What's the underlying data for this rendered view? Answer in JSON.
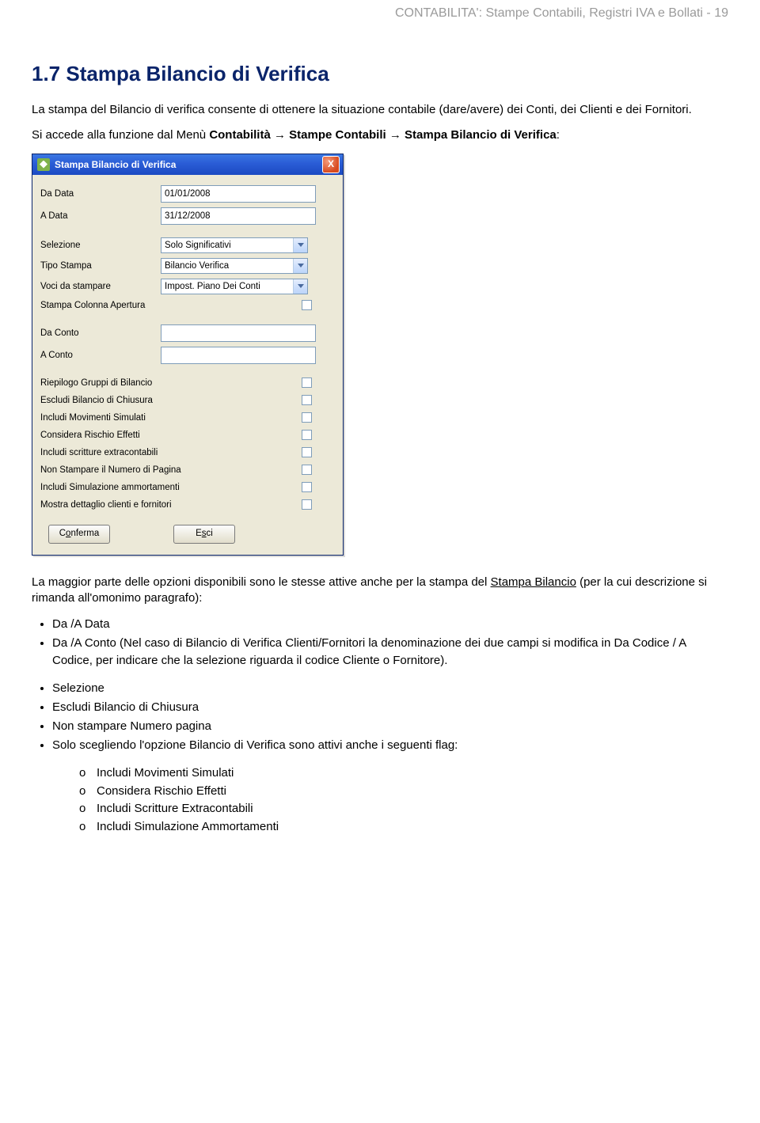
{
  "header": "CONTABILITA': Stampe Contabili, Registri IVA e Bollati - 19",
  "sectionTitle": "1.7 Stampa Bilancio di Verifica",
  "intro": "La stampa del Bilancio di verifica consente di ottenere la situazione contabile (dare/avere) dei Conti, dei Clienti e dei Fornitori.",
  "navPrefix": "Si accede alla funzione dal Menù ",
  "nav": {
    "m1": "Contabilità",
    "m2": "Stampe Contabili",
    "m3": "Stampa Bilancio di Verifica",
    "arrow": "→"
  },
  "colon": ":",
  "dialog": {
    "title": "Stampa Bilancio di Verifica",
    "close": "X",
    "fields": {
      "daData": {
        "label": "Da Data",
        "value": "01/01/2008"
      },
      "aData": {
        "label": "A Data",
        "value": "31/12/2008"
      },
      "selezione": {
        "label": "Selezione",
        "value": "Solo Significativi"
      },
      "tipoStampa": {
        "label": "Tipo Stampa",
        "value": "Bilancio Verifica"
      },
      "voci": {
        "label": "Voci da stampare",
        "value": "Impost. Piano Dei Conti"
      },
      "colApertura": {
        "label": "Stampa Colonna Apertura"
      },
      "daConto": {
        "label": "Da Conto",
        "value": ""
      },
      "aConto": {
        "label": "A Conto",
        "value": ""
      }
    },
    "checks": [
      "Riepilogo Gruppi di Bilancio",
      "Escludi Bilancio di Chiusura",
      "Includi Movimenti Simulati",
      "Considera Rischio Effetti",
      "Includi scritture extracontabili",
      "Non Stampare il Numero di Pagina",
      "Includi Simulazione ammortamenti",
      "Mostra dettaglio clienti e fornitori"
    ],
    "buttons": {
      "confirmPre": "C",
      "confirmUL": "o",
      "confirmPost": "nferma",
      "exitPre": "E",
      "exitUL": "s",
      "exitPost": "ci"
    }
  },
  "afterDlg1a": "La maggior parte delle opzioni disponibili sono le stesse attive anche per la stampa del ",
  "afterDlg1Link": "Stampa Bilancio",
  "afterDlg1b": " (per la cui descrizione si rimanda all'omonimo paragrafo):",
  "bulletsA": {
    "b1": "Da /A Data",
    "b2a": "Da /A Conto",
    "b2b": "   (Nel caso di Bilancio di Verifica Clienti/Fornitori la denominazione dei due campi si modifica in ",
    "b2c": "Da Codice / A Codice",
    "b2d": ", per indicare che la selezione riguarda il codice Cliente o Fornitore)."
  },
  "bulletsB": {
    "b1": "Selezione",
    "b2": "Escludi Bilancio di Chiusura",
    "b3": "Non stampare Numero pagina",
    "b4": "Solo scegliendo l'opzione Bilancio di Verifica sono attivi anche i seguenti flag:"
  },
  "sub": {
    "s1": "Includi Movimenti Simulati",
    "s2": "Considera Rischio Effetti",
    "s3": "Includi Scritture Extracontabili",
    "s4": "Includi Simulazione Ammortamenti"
  }
}
